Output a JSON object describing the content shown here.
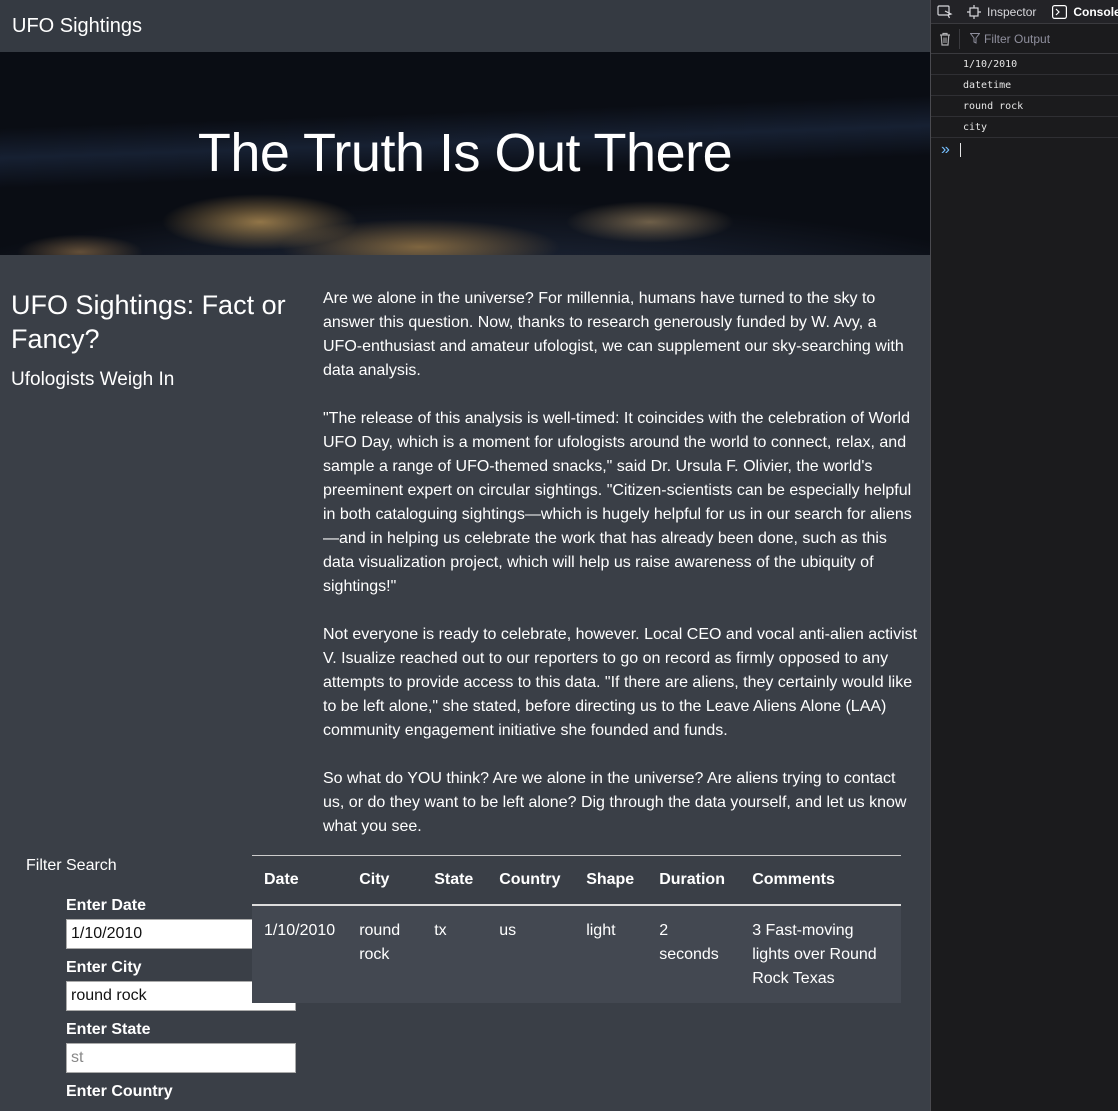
{
  "navbar": {
    "brand": "UFO Sightings"
  },
  "hero": {
    "title": "The Truth Is Out There"
  },
  "sidebar": {
    "title": "UFO Sightings: Fact or Fancy?",
    "subtitle": "Ufologists Weigh In"
  },
  "article": {
    "paragraphs": [
      "Are we alone in the universe? For millennia, humans have turned to the sky to answer this question. Now, thanks to research generously funded by W. Avy, a UFO-enthusiast and amateur ufologist, we can supplement our sky-searching with data analysis.",
      "\"The release of this analysis is well-timed: It coincides with the celebration of World UFO Day, which is a moment for ufologists around the world to connect, relax, and sample a range of UFO-themed snacks,\" said Dr. Ursula F. Olivier, the world's preeminent expert on circular sightings. \"Citizen-scientists can be especially helpful in both cataloguing sightings—which is hugely helpful for us in our search for aliens—and in helping us celebrate the work that has already been done, such as this data visualization project, which will help us raise awareness of the ubiquity of sightings!\"",
      "Not everyone is ready to celebrate, however. Local CEO and vocal anti-alien activist V. Isualize reached out to our reporters to go on record as firmly opposed to any attempts to provide access to this data. \"If there are aliens, they certainly would like to be left alone,\" she stated, before directing us to the Leave Aliens Alone (LAA) community engagement initiative she founded and funds.",
      "So what do YOU think? Are we alone in the universe? Are aliens trying to contact us, or do they want to be left alone? Dig through the data yourself, and let us know what you see."
    ]
  },
  "filter": {
    "title": "Filter Search",
    "date": {
      "label": "Enter Date",
      "value": "1/10/2010"
    },
    "city": {
      "label": "Enter City",
      "value": "round rock"
    },
    "state": {
      "label": "Enter State",
      "value": "",
      "placeholder": "st"
    },
    "country": {
      "label": "Enter Country"
    }
  },
  "table": {
    "headers": [
      "Date",
      "City",
      "State",
      "Country",
      "Shape",
      "Duration",
      "Comments"
    ],
    "rows": [
      [
        "1/10/2010",
        "round rock",
        "tx",
        "us",
        "light",
        "2 seconds",
        "3 Fast-moving lights over Round Rock Texas"
      ]
    ]
  },
  "devtools": {
    "tabs": {
      "inspector": "Inspector",
      "console": "Console"
    },
    "filter_placeholder": "Filter Output",
    "log": [
      "1/10/2010",
      "datetime",
      "round rock",
      "city"
    ],
    "icons": {
      "picker": "element-picker-icon",
      "inspector": "inspector-icon",
      "console": "console-icon",
      "trash": "trash-icon",
      "filter": "filter-icon",
      "prompt": "prompt-chevron-icon"
    }
  }
}
